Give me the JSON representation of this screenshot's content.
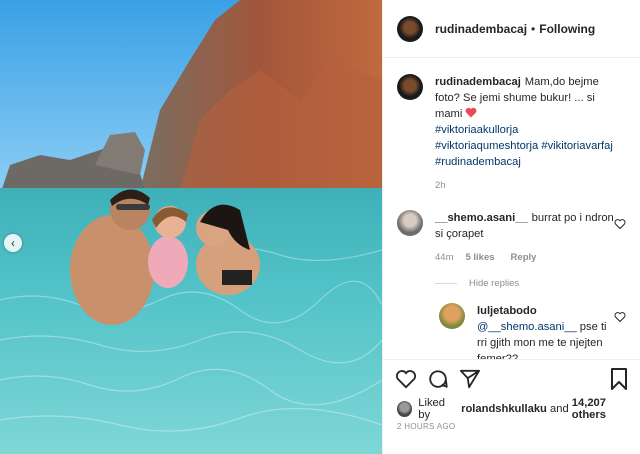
{
  "post": {
    "author": "rudinadembacaj",
    "separator": "•",
    "follow_status": "Following",
    "caption": {
      "username": "rudinadembacaj",
      "text": "Mam,do bejme foto? Se jemi shume bukur! ... si mami",
      "hashtags": [
        "#viktoriaakullorja",
        "#viktoriaqumeshtorja",
        "#vikitoriavarfaj",
        "#rudinadembacaj"
      ],
      "time": "2h"
    },
    "comments": [
      {
        "username": "__shemo.asani__",
        "text": "burrat po i ndron si çorapet",
        "time": "44m",
        "likes": "5 likes",
        "reply_label": "Reply"
      }
    ],
    "hide_replies_label": "Hide replies",
    "reply": {
      "username": "luljetabodo",
      "mention": "@__shemo.asani__",
      "text": "pse ti rri gjith mon me te njejten femer??"
    },
    "liked_by": {
      "prefix": "Liked by",
      "user": "rolandshkullaku",
      "conjunction": "and",
      "others": "14,207 others"
    },
    "timestamp": "2 HOURS AGO",
    "carousel_arrow": "‹"
  },
  "icons": [
    "heart-icon",
    "comment-icon",
    "share-icon",
    "bookmark-icon",
    "heart-emoji-icon"
  ],
  "colors": {
    "heart_red": "#ed4956",
    "link_blue": "#00376b",
    "muted": "#8e8e8e"
  }
}
